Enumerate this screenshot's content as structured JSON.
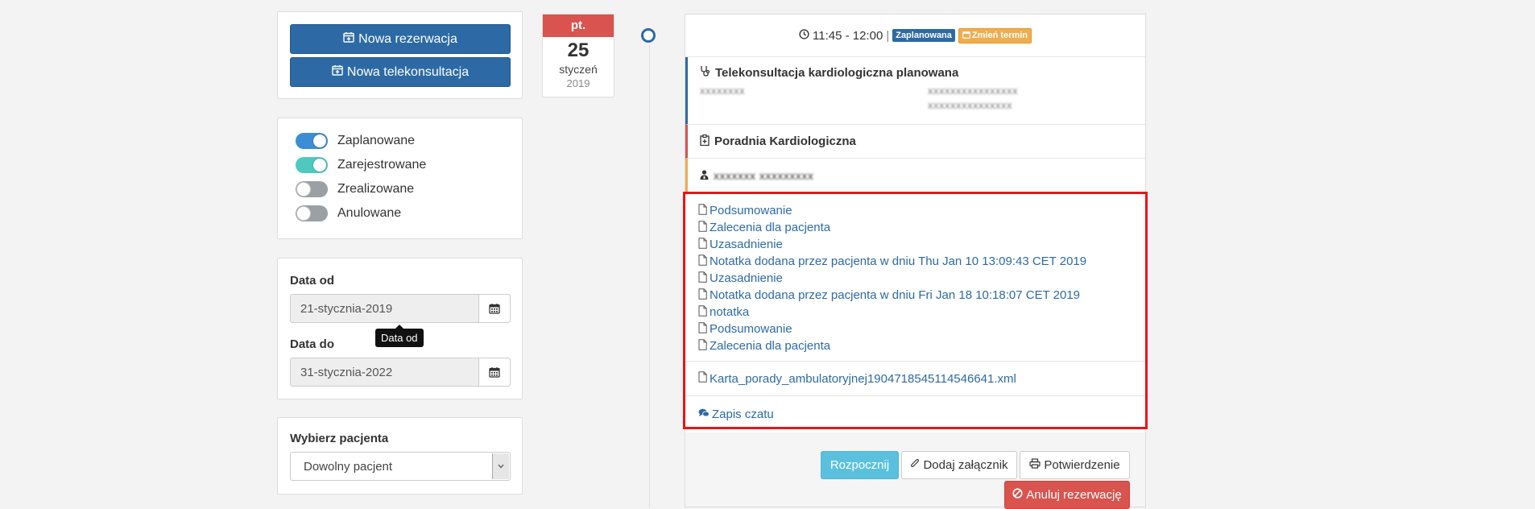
{
  "actions": {
    "new_reservation": "Nowa rezerwacja",
    "new_teleconsultation": "Nowa telekonsultacja"
  },
  "filters": [
    {
      "label": "Zaplanowane",
      "state": "on",
      "color": "#3c8dd4"
    },
    {
      "label": "Zarejestrowane",
      "state": "on",
      "color": "#4fc9c0"
    },
    {
      "label": "Zrealizowane",
      "state": "off",
      "color": "#9aa0a4"
    },
    {
      "label": "Anulowane",
      "state": "off",
      "color": "#9aa0a4"
    }
  ],
  "dates": {
    "from_label": "Data od",
    "from_value": "21-stycznia-2019",
    "to_label": "Data do",
    "to_value": "31-stycznia-2022",
    "tooltip": "Data od"
  },
  "patient": {
    "label": "Wybierz pacjenta",
    "selected": "Dowolny pacjent"
  },
  "calendar": {
    "dow": "pt.",
    "day": "25",
    "month": "styczeń",
    "year": "2019"
  },
  "event": {
    "time": "11:45 - 12:00",
    "separator": "|",
    "status": "Zaplanowana",
    "reschedule": "Zmień termin",
    "title": "Telekonsultacja kardiologiczna planowana",
    "blurred_left": "xxxxxxxx",
    "blurred_right_1": "xxxxxxxxxxxxxxxx",
    "blurred_right_2": "xxxxxxxxxxxxxxx",
    "clinic": "Poradnia Kardiologiczna",
    "doctor_blurred": "xxxxxxx xxxxxxxxx",
    "documents": [
      "Podsumowanie",
      "Zalecenia dla pacjenta",
      "Uzasadnienie",
      "Notatka dodana przez pacjenta w dniu Thu Jan 10 13:09:43 CET 2019",
      "Uzasadnienie",
      "Notatka dodana przez pacjenta w dniu Fri Jan 18 10:18:07 CET 2019",
      "notatka",
      "Podsumowanie",
      "Zalecenia dla pacjenta"
    ],
    "attachment": "Karta_porady_ambulatoryjnej1904718545114546641.xml",
    "chat": "Zapis czatu",
    "buttons": {
      "start": "Rozpocznij",
      "attach": "Dodaj załącznik",
      "confirm": "Potwierdzenie",
      "cancel": "Anuluj rezerwację"
    }
  },
  "colors": {
    "primary": "#2d6aa5",
    "danger": "#d9534f",
    "info": "#5bc0de",
    "warning": "#f0ad4e",
    "highlight": "#e8151b"
  },
  "icons": [
    "calendar-plus-icon",
    "clock-icon",
    "calendar-icon",
    "stethoscope-icon",
    "clinic-icon",
    "doctor-icon",
    "file-icon",
    "comments-icon",
    "paperclip-icon",
    "print-icon",
    "ban-icon",
    "chevron-down-icon"
  ]
}
